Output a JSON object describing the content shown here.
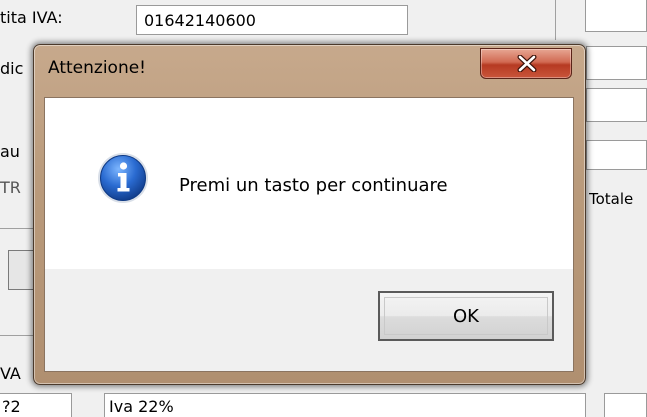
{
  "background": {
    "partita_iva_label": "tita IVA:",
    "partita_iva_value": "01642140600",
    "codice_label": "dic",
    "causale_label": "au",
    "tr_label": "TR",
    "totale_label": "Totale",
    "iva_label": "VA",
    "code_value": "?2",
    "iva_value": "Iva 22%"
  },
  "dialog": {
    "title": "Attenzione!",
    "message": "Premi un tasto per continuare",
    "ok_label": "OK",
    "close_glyph": "x"
  },
  "colors": {
    "frame": "#bb9c7d",
    "close_button": "#c8523a",
    "info_icon": "#2a6bd1"
  },
  "icons": {
    "dialog_icon": "info-icon",
    "close_icon": "close-icon"
  }
}
